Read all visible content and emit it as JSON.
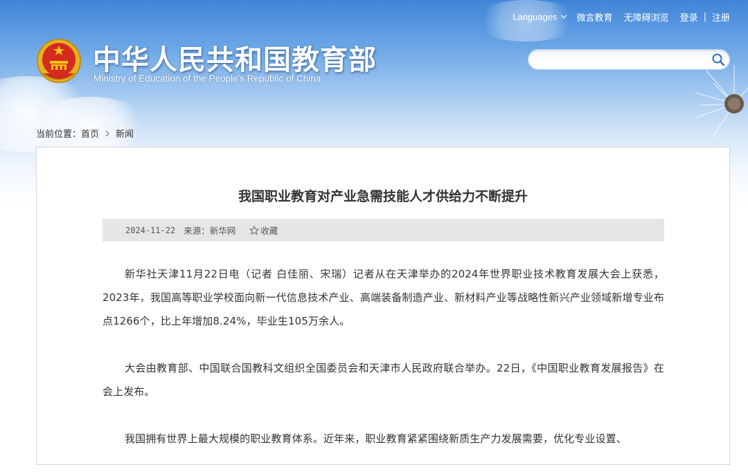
{
  "topbar": {
    "languages": "Languages",
    "weiyan": "微言教育",
    "accessibility": "无障碍浏览",
    "login": "登录",
    "register": "注册"
  },
  "site": {
    "title_cn": "中华人民共和国教育部",
    "title_en": "Ministry of Education of the People's Republic of China"
  },
  "search": {
    "placeholder": ""
  },
  "breadcrumb": {
    "label": "当前位置：",
    "home": "首页",
    "current": "新闻"
  },
  "article": {
    "title": "我国职业教育对产业急需技能人才供给力不断提升",
    "date": "2024-11-22",
    "source": "来源：新华网",
    "favorite": "收藏",
    "paragraphs": [
      "新华社天津11月22日电（记者 白佳丽、宋瑞）记者从在天津举办的2024年世界职业技术教育发展大会上获悉，2023年，我国高等职业学校面向新一代信息技术产业、高端装备制造产业、新材料产业等战略性新兴产业领域新增专业布点1266个，比上年增加8.24%，毕业生105万余人。",
      "大会由教育部、中国联合国教科文组织全国委员会和天津市人民政府联合举办。22日，《中国职业教育发展报告》在会上发布。",
      "我国拥有世界上最大规模的职业教育体系。近年来，职业教育紧紧围绕新质生产力发展需要，优化专业设置、"
    ]
  },
  "colors": {
    "sky_top": "#3f84d7",
    "text": "#333333",
    "meta_bg": "#e6e6e6",
    "border": "#d6d6d6"
  }
}
